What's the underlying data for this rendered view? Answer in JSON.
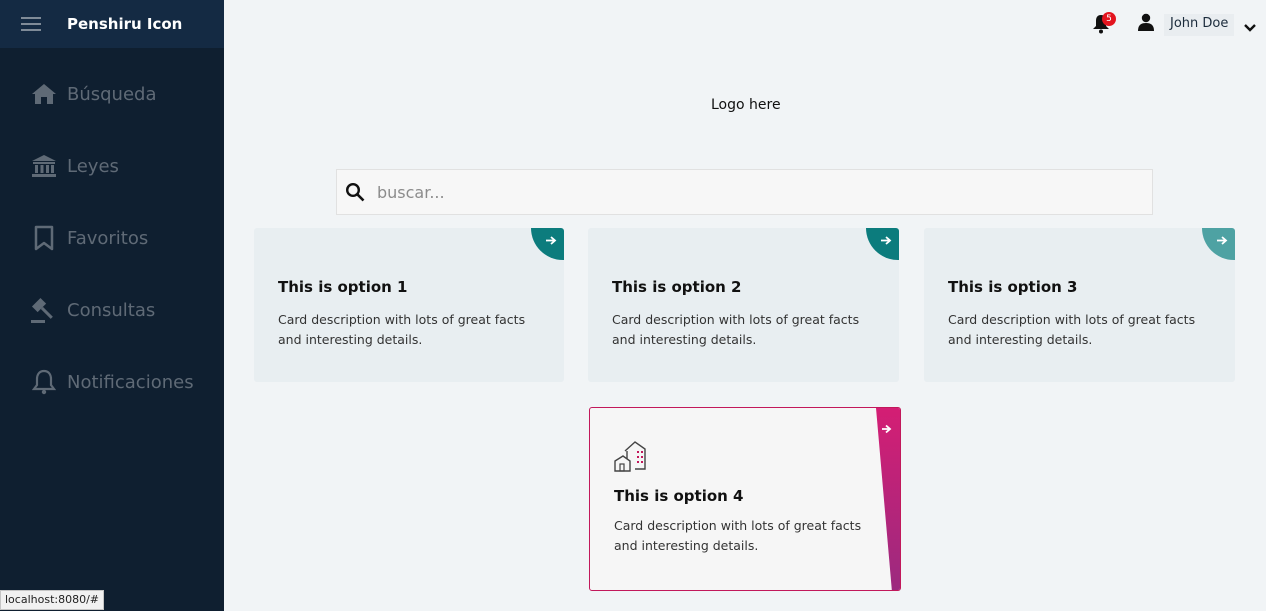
{
  "app": {
    "brand": "Penshiru Icon"
  },
  "sidebar": {
    "items": [
      {
        "label": "Búsqueda",
        "icon": "home-icon"
      },
      {
        "label": "Leyes",
        "icon": "institution-icon"
      },
      {
        "label": "Favoritos",
        "icon": "bookmark-icon"
      },
      {
        "label": "Consultas",
        "icon": "gavel-icon"
      },
      {
        "label": "Notificaciones",
        "icon": "bell-icon"
      }
    ]
  },
  "topbar": {
    "notifications_count": "5",
    "user_name": "John Doe"
  },
  "main": {
    "logo_text": "Logo here",
    "search": {
      "placeholder": "buscar...",
      "value": ""
    },
    "cards": [
      {
        "title": "This is option 1",
        "description": "Card description with lots of great facts and interesting details."
      },
      {
        "title": "This is option 2",
        "description": "Card description with lots of great facts and interesting details."
      },
      {
        "title": "This is option 3",
        "description": "Card description with lots of great facts and interesting details."
      },
      {
        "title": "This is option 4",
        "description": "Card description with lots of great facts and interesting details."
      }
    ]
  },
  "statusbar": {
    "url": "localhost:8080/#"
  },
  "colors": {
    "sidebar": "#0f1f30",
    "brand_bar": "#142a43",
    "accent_teal": "#0c7c7d",
    "accent_magenta": "#c2185b",
    "badge": "#e3141e"
  }
}
